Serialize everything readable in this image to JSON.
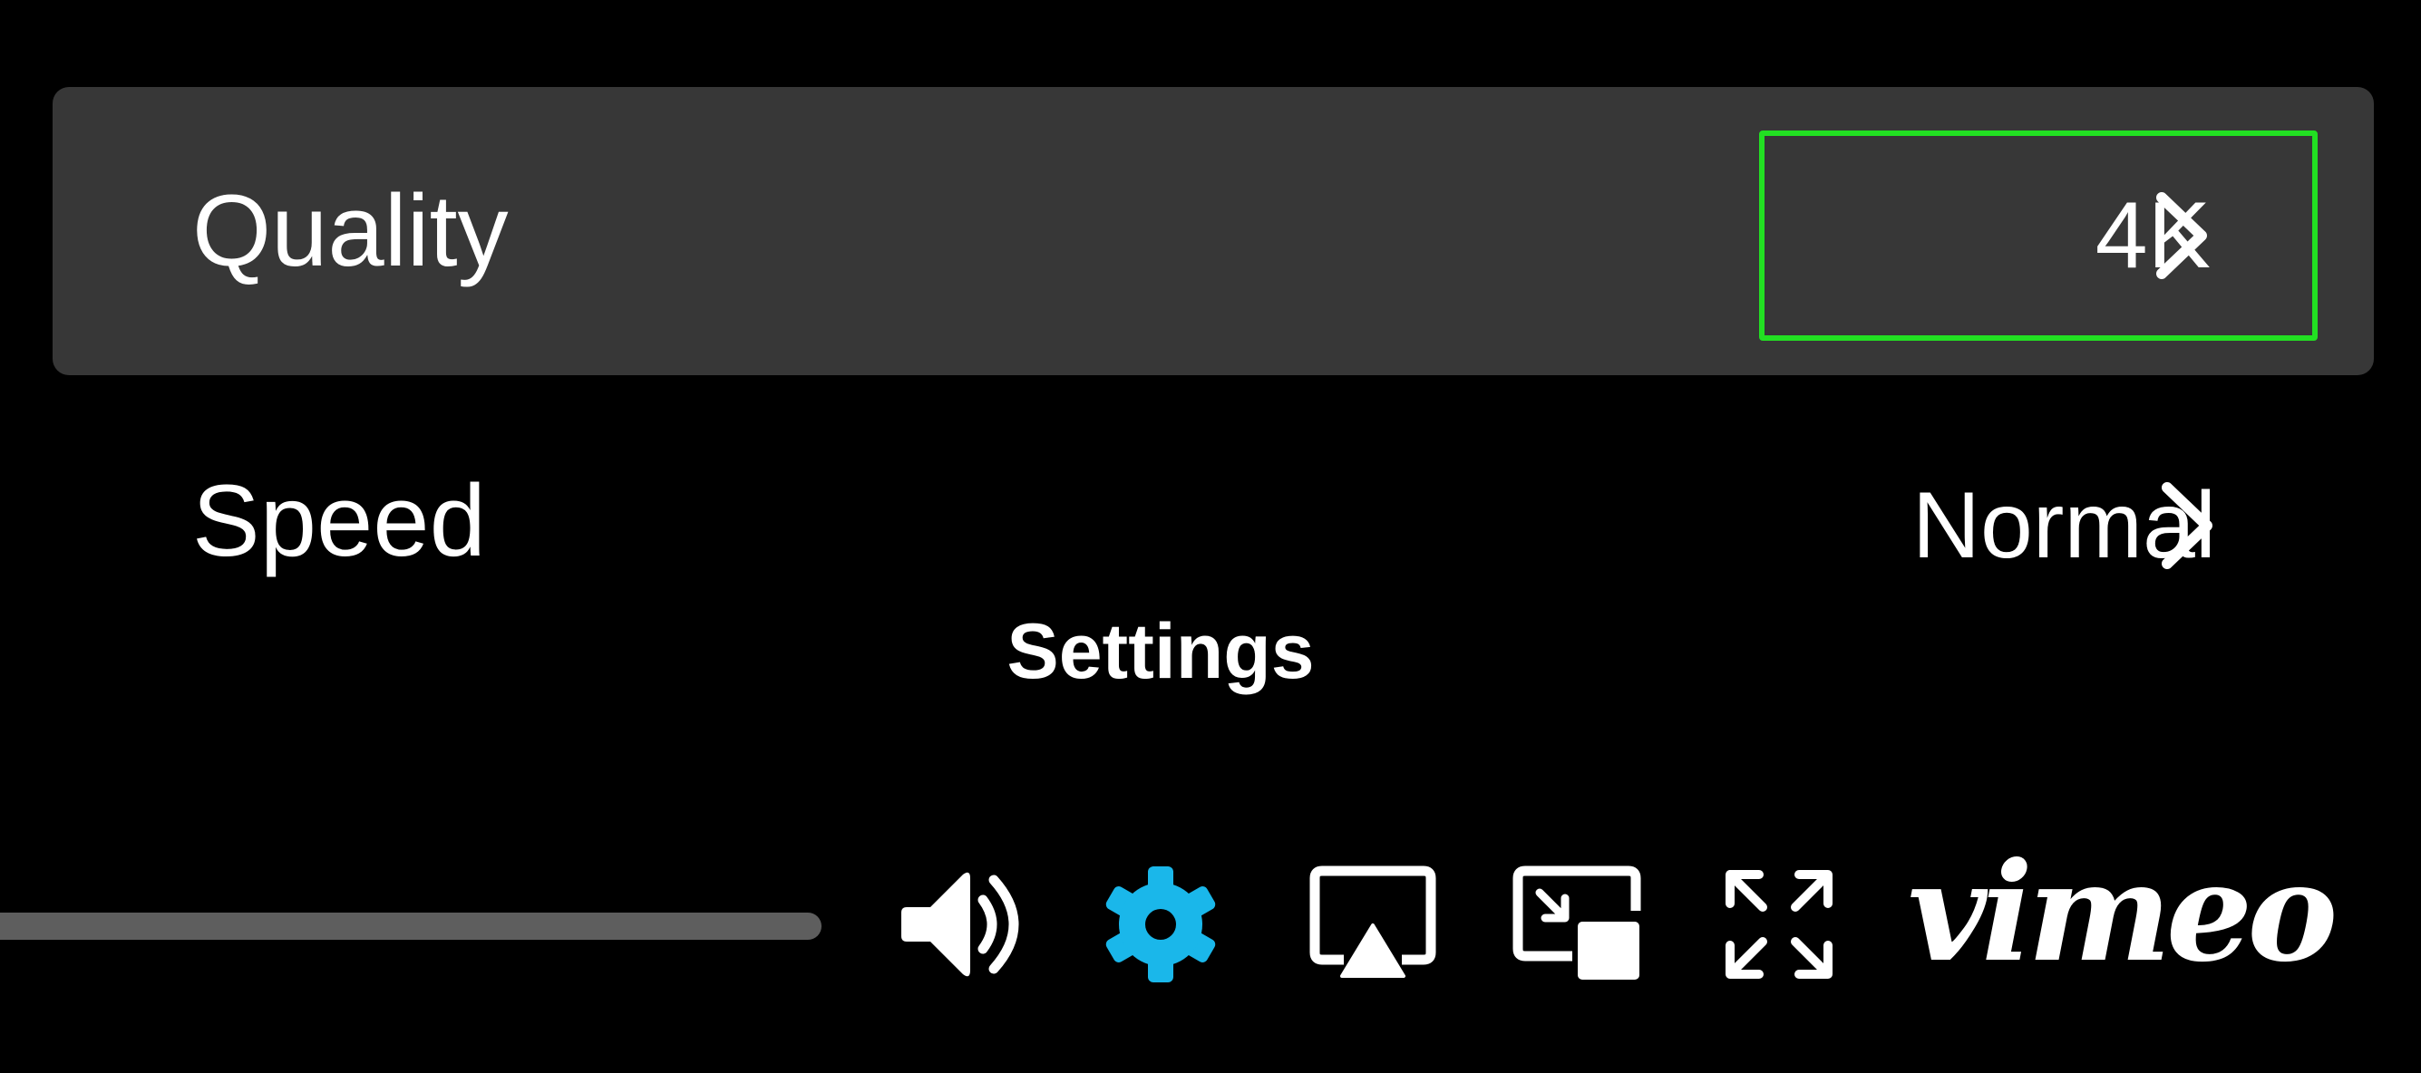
{
  "settings_menu": {
    "rows": [
      {
        "label": "Quality",
        "value": "4K",
        "highlighted": true
      },
      {
        "label": "Speed",
        "value": "Normal",
        "highlighted": false
      }
    ],
    "highlight_color": "#22e022",
    "row_bg": "#373737"
  },
  "tooltip": {
    "text": "Settings"
  },
  "controls": {
    "icons": [
      "volume-icon",
      "gear-icon",
      "airplay-icon",
      "pip-icon",
      "fullscreen-icon"
    ],
    "accent": "#1ab7ea",
    "brand": "vimeo"
  }
}
